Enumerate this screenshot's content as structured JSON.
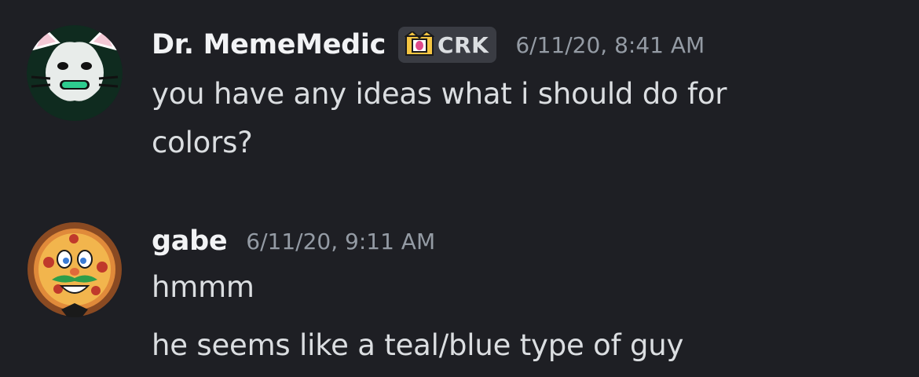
{
  "messages": [
    {
      "username": "Dr. MemeMedic",
      "tag": "CRK",
      "timestamp": "6/11/20, 8:41 AM",
      "lines": [
        "you have any ideas what i should do for",
        "colors?"
      ],
      "avatar_icon": "meme-medic-cat-avatar",
      "colors": {
        "accent": "#2ecc8f"
      }
    },
    {
      "username": "gabe",
      "timestamp": "6/11/20, 9:11 AM",
      "lines": [
        "hmmm",
        "he seems like a teal/blue type of guy"
      ],
      "avatar_icon": "pizza-face-avatar"
    }
  ],
  "theme": {
    "background": "#1e1f24",
    "username_color": "#f2f3f5",
    "text_color": "#dbdee1",
    "timestamp_color": "#949ba4",
    "tag_background": "#3a3c43"
  }
}
